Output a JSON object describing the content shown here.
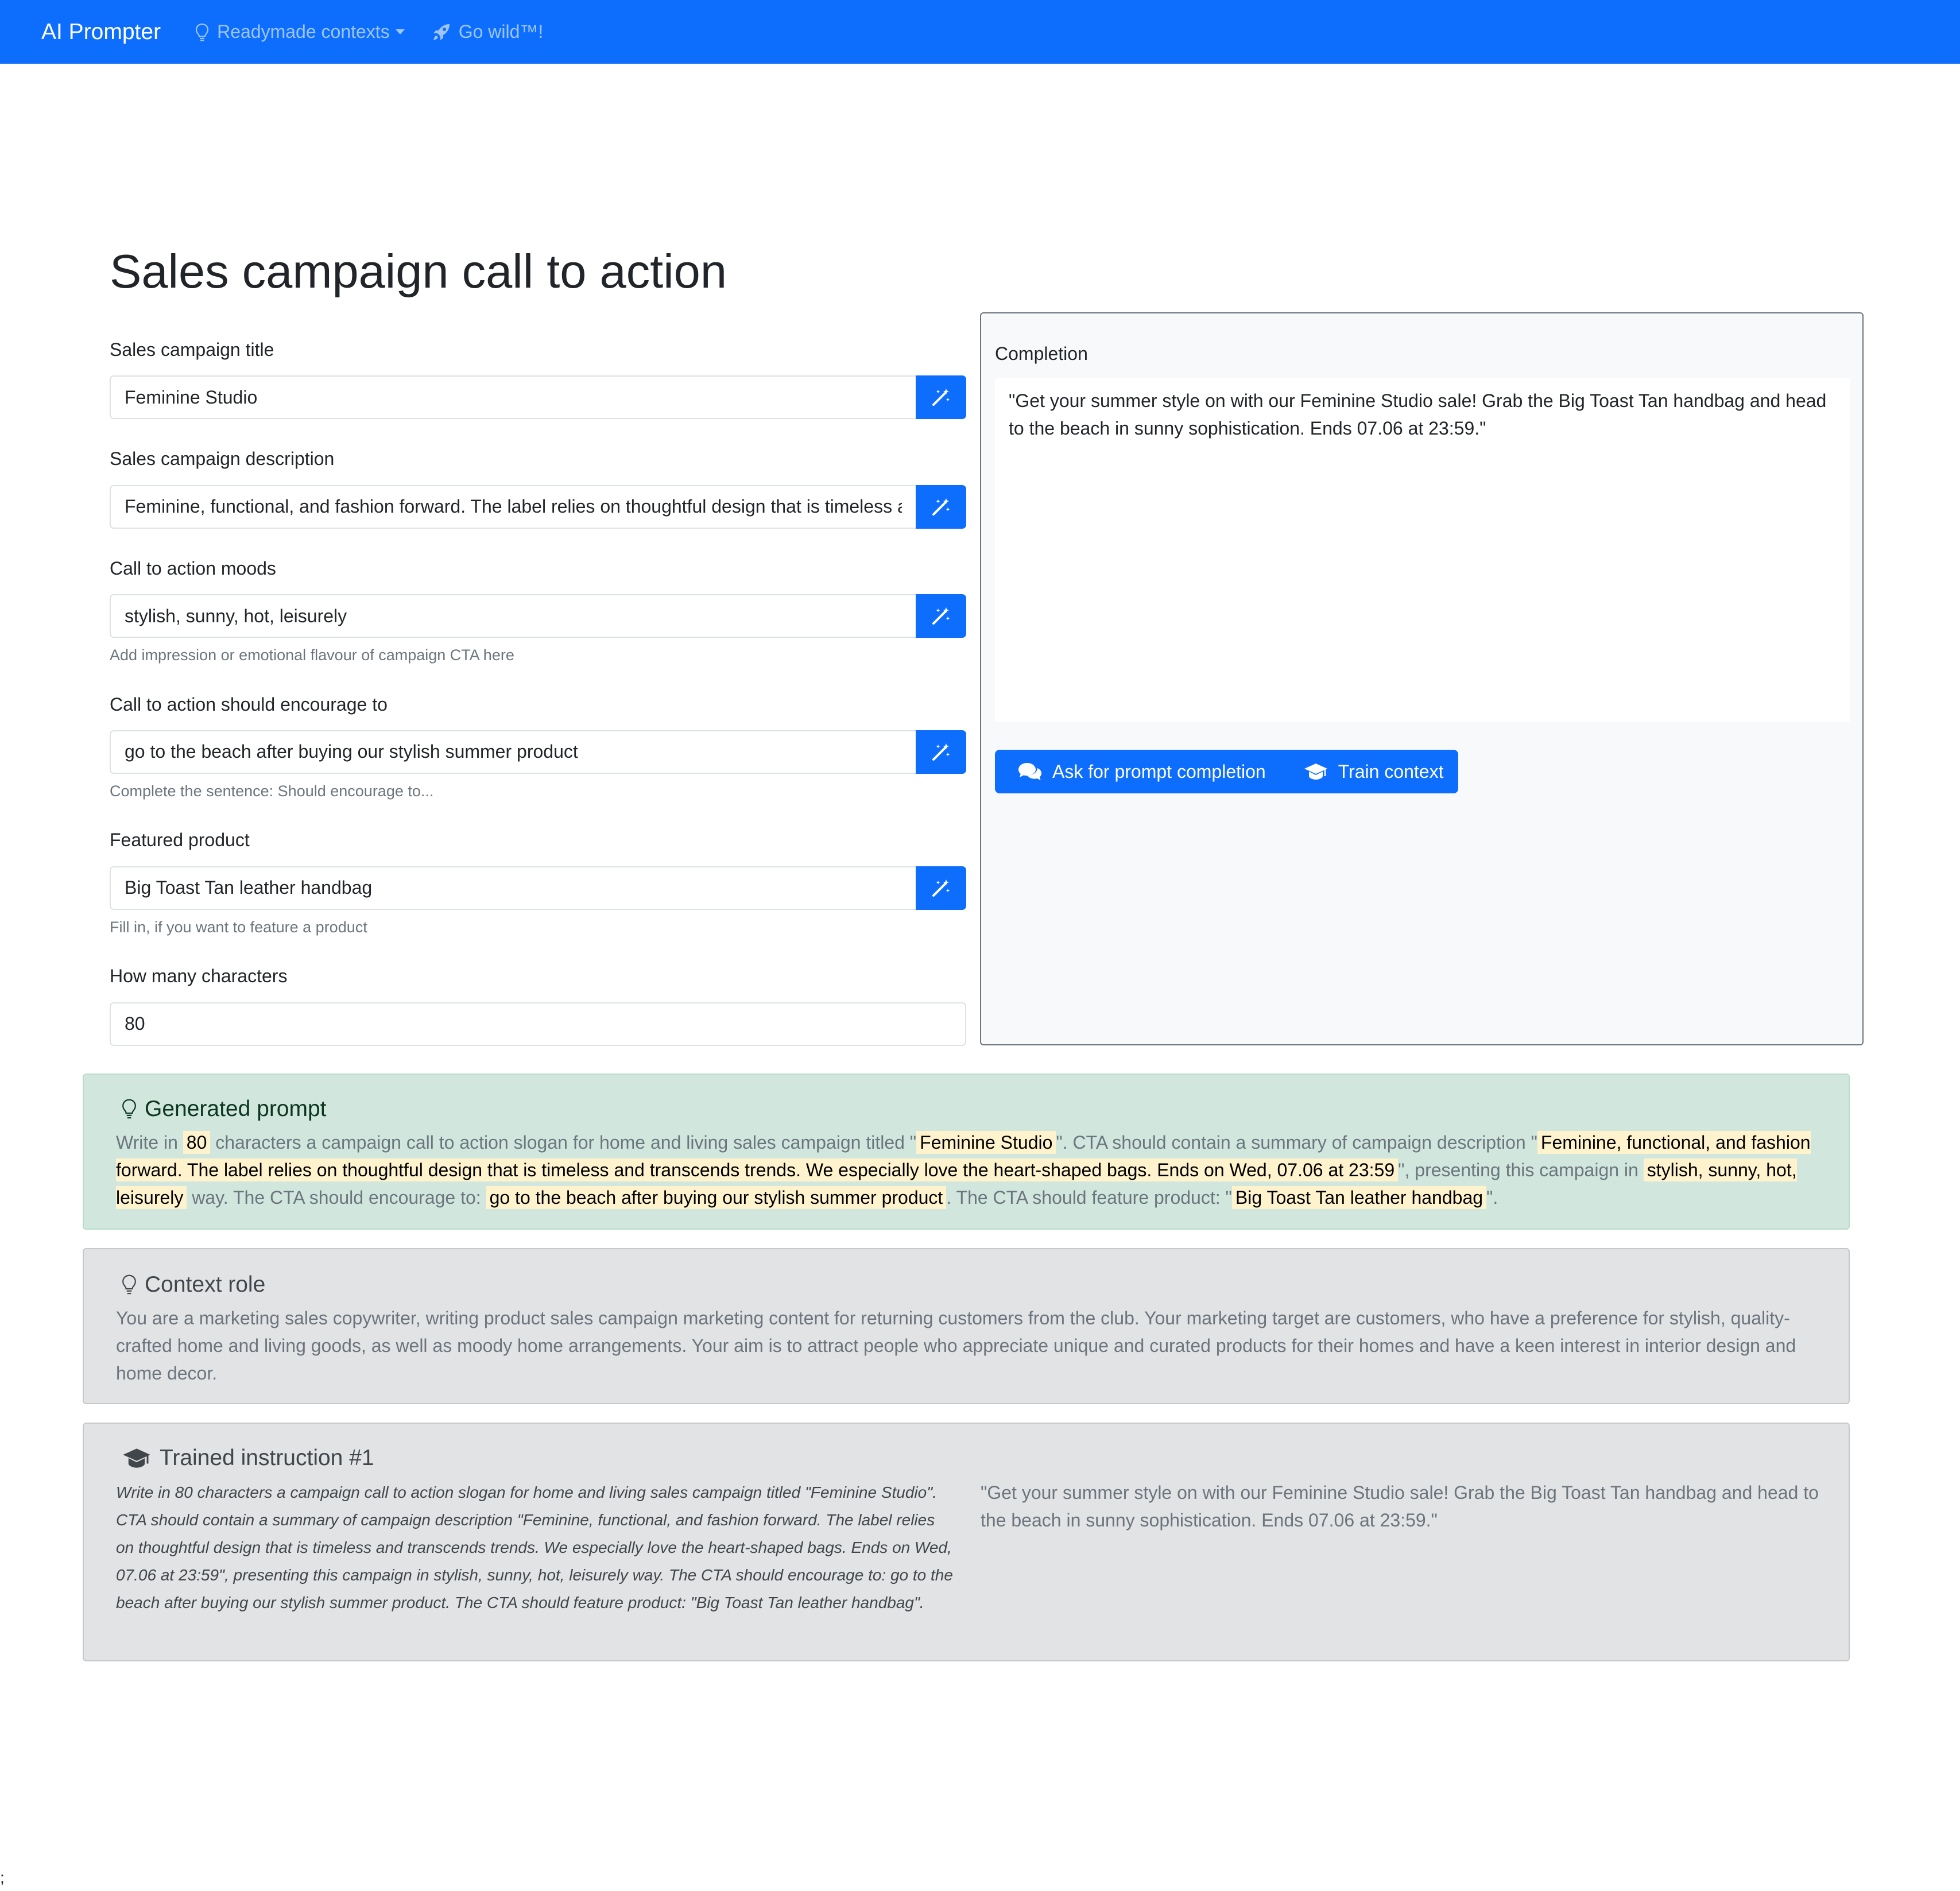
{
  "navbar": {
    "brand": "AI Prompter",
    "items": [
      {
        "label": "Readymade contexts",
        "icon": "lightbulb-icon",
        "dropdown": true
      },
      {
        "label": "Go wild™!",
        "icon": "rocket-icon",
        "dropdown": false
      }
    ]
  },
  "page": {
    "title": "Sales campaign call to action"
  },
  "form": {
    "fields": [
      {
        "label": "Sales campaign title",
        "value": "Feminine Studio",
        "help": ""
      },
      {
        "label": "Sales campaign description",
        "value": "Feminine, functional, and fashion forward. The label relies on thoughtful design that is timeless and transcends trends. We especially love the heart-shaped bags. Ends on Wed, 07.06 at 23:59",
        "help": ""
      },
      {
        "label": "Call to action moods",
        "value": "stylish, sunny, hot, leisurely",
        "help": "Add impression or emotional flavour of campaign CTA here"
      },
      {
        "label": "Call to action should encourage to",
        "value": "go to the beach after buying our stylish summer product",
        "help": "Complete the sentence: Should encourage to..."
      },
      {
        "label": "Featured product",
        "value": "Big Toast Tan leather handbag",
        "help": "Fill in, if you want to feature a product"
      },
      {
        "label": "How many characters",
        "value": "80",
        "help": ""
      }
    ],
    "wand_icon": "magic-wand-icon"
  },
  "completion": {
    "label": "Completion",
    "text": "\"Get your summer style on with our Feminine Studio sale! Grab the Big Toast Tan handbag and head to the beach in sunny sophistication. Ends 07.06 at 23:59.\"",
    "ask_button": "Ask for prompt completion",
    "train_button": "Train context"
  },
  "generated_prompt": {
    "title": "Generated prompt",
    "parts": [
      {
        "text": "Write in ",
        "highlight": false
      },
      {
        "text": "80",
        "highlight": true
      },
      {
        "text": " characters a campaign call to action slogan for home and living sales campaign titled \"",
        "highlight": false
      },
      {
        "text": "Feminine Studio",
        "highlight": true
      },
      {
        "text": "\". CTA should contain a summary of campaign description \"",
        "highlight": false
      },
      {
        "text": "Feminine, functional, and fashion forward. The label relies on thoughtful design that is timeless and transcends trends. We especially love the heart-shaped bags. Ends on Wed, 07.06 at 23:59",
        "highlight": true
      },
      {
        "text": "\", presenting this campaign in ",
        "highlight": false
      },
      {
        "text": "stylish, sunny, hot, leisurely",
        "highlight": true
      },
      {
        "text": " way. The CTA should encourage to: ",
        "highlight": false
      },
      {
        "text": "go to the beach after buying our stylish summer product",
        "highlight": true
      },
      {
        "text": ". The CTA should feature product: \"",
        "highlight": false
      },
      {
        "text": "Big Toast Tan leather handbag",
        "highlight": true
      },
      {
        "text": "\".",
        "highlight": false
      }
    ]
  },
  "context_role": {
    "title": "Context role",
    "text": "You are a marketing sales copywriter, writing product sales campaign marketing content for returning customers from the club. Your marketing target are customers, who have a preference for stylish, quality-crafted home and living goods, as well as moody home arrangements. Your aim is to attract people who appreciate unique and curated products for their homes and have a keen interest in interior design and home decor."
  },
  "trained_instruction": {
    "title": "Trained instruction #1",
    "instruction": "Write in 80 characters a campaign call to action slogan for home and living sales campaign titled \"Feminine Studio\". CTA should contain a summary of campaign description \"Feminine, functional, and fashion forward. The label relies on thoughtful design that is timeless and transcends trends. We especially love the heart-shaped bags. Ends on Wed, 07.06 at 23:59\", presenting this campaign in stylish, sunny, hot, leisurely way. The CTA should encourage to: go to the beach after buying our stylish summer product. The CTA should feature product: \"Big Toast Tan leather handbag\".",
    "completion": "\"Get your summer style on with our Feminine Studio sale! Grab the Big Toast Tan handbag and head to the beach in sunny sophistication. Ends 07.06 at 23:59.\""
  },
  "footer": {
    "stray_text": ";"
  },
  "colors": {
    "primary": "#0d6efd",
    "success_bg": "#d1e7dd",
    "secondary_bg": "#e2e3e5",
    "highlight": "#fff3cd"
  }
}
